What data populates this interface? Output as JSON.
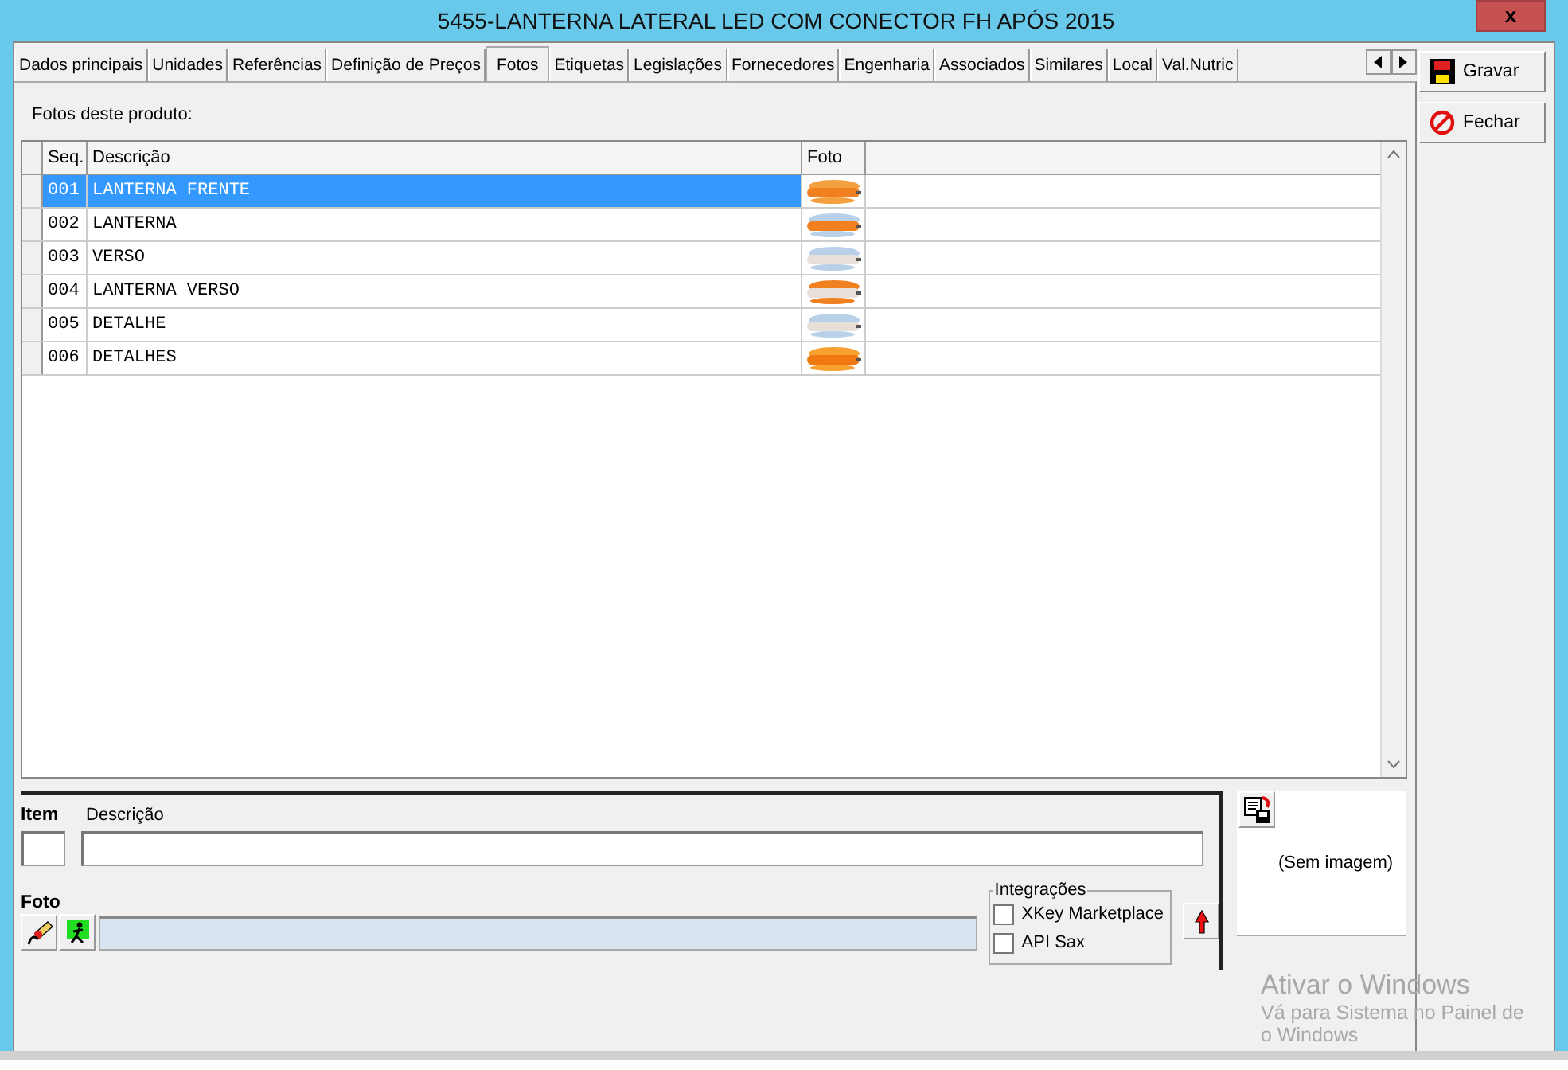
{
  "window": {
    "title": "5455-LANTERNA LATERAL LED COM CONECTOR FH APÓS 2015",
    "close": "x"
  },
  "tabs": [
    {
      "label": "Dados principais",
      "selected": false
    },
    {
      "label": "Unidades",
      "selected": false
    },
    {
      "label": "Referências",
      "selected": false
    },
    {
      "label": "Definição de Preços",
      "selected": false
    },
    {
      "label": "Fotos",
      "selected": true
    },
    {
      "label": "Etiquetas",
      "selected": false
    },
    {
      "label": "Legislações",
      "selected": false
    },
    {
      "label": "Fornecedores",
      "selected": false
    },
    {
      "label": "Engenharia",
      "selected": false
    },
    {
      "label": "Associados",
      "selected": false
    },
    {
      "label": "Similares",
      "selected": false
    },
    {
      "label": "Local",
      "selected": false
    },
    {
      "label": "Val.Nutric",
      "selected": false
    }
  ],
  "side_buttons": [
    {
      "label": "Gravar",
      "kind": "save"
    },
    {
      "label": "Fechar",
      "kind": "close"
    }
  ],
  "section_label": "Fotos deste produto:",
  "table": {
    "columns": [
      "Seq.",
      "Descrição",
      "Foto"
    ],
    "rows": [
      {
        "seq": "001",
        "description": "LANTERNA FRENTE",
        "selected": true
      },
      {
        "seq": "002",
        "description": "LANTERNA",
        "selected": false
      },
      {
        "seq": "003",
        "description": "VERSO",
        "selected": false
      },
      {
        "seq": "004",
        "description": "LANTERNA VERSO",
        "selected": false
      },
      {
        "seq": "005",
        "description": "DETALHE",
        "selected": false
      },
      {
        "seq": "006",
        "description": "DETALHES",
        "selected": false
      }
    ]
  },
  "editor": {
    "item_label": "Item",
    "description_label": "Descrição",
    "foto_label": "Foto"
  },
  "integrations": {
    "title": "Integrações",
    "options": [
      {
        "label": "XKey Marketplace",
        "checked": false
      },
      {
        "label": "API Sax",
        "checked": false
      }
    ]
  },
  "image_preview": {
    "empty_text": "(Sem imagem)"
  },
  "watermark": {
    "title": "Ativar o Windows",
    "line_1": "Vá para Sistema no Painel de",
    "line_2": "o Windows"
  }
}
